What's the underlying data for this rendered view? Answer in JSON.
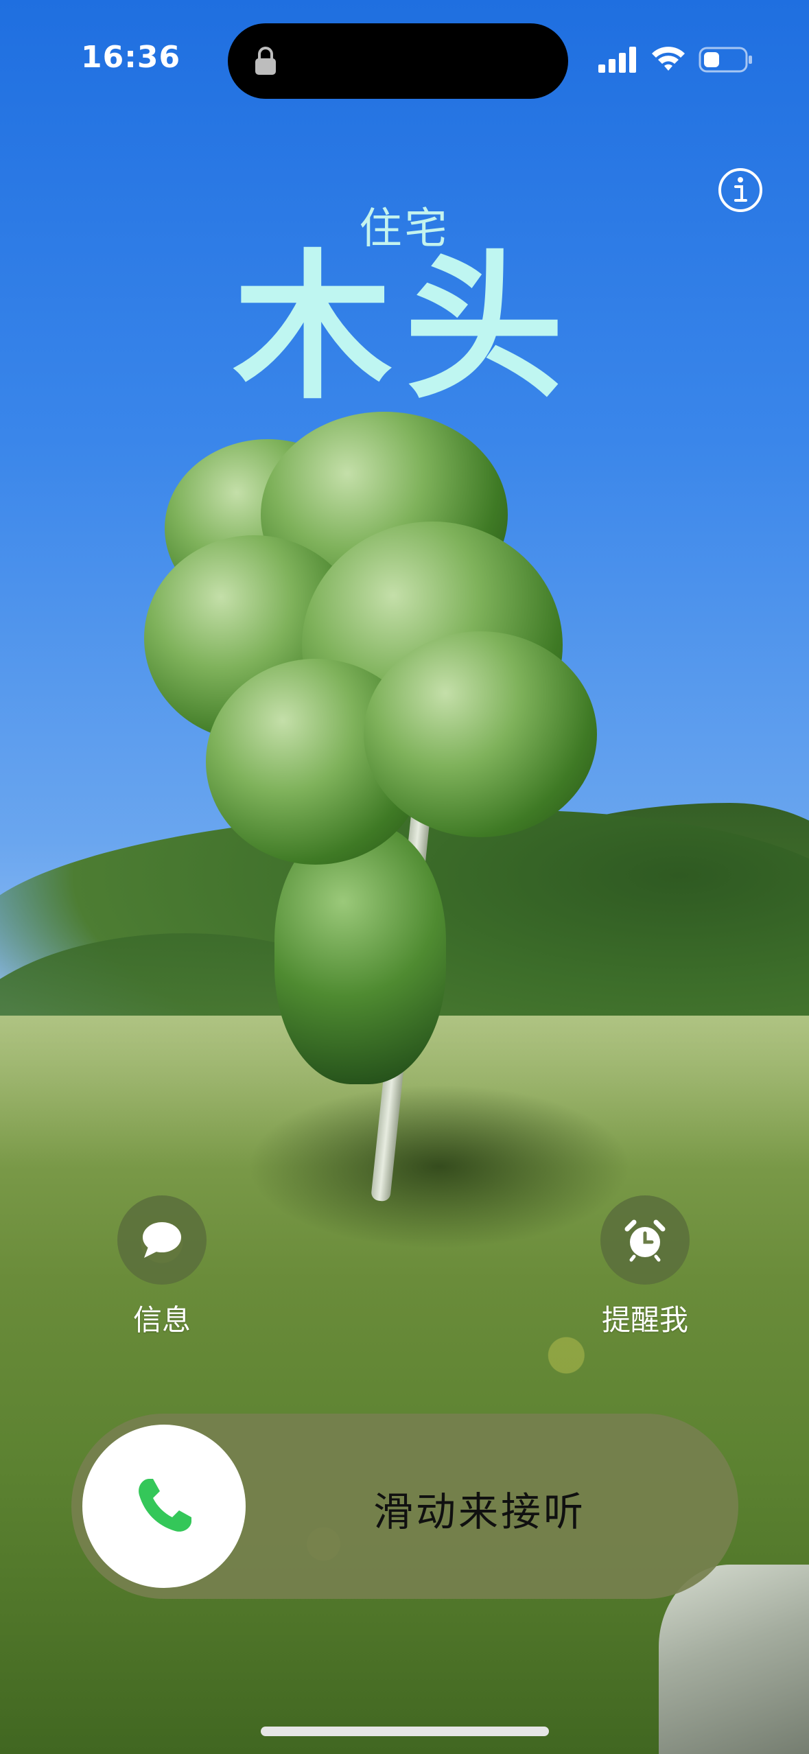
{
  "status_bar": {
    "time": "16:36",
    "icons": [
      "lock-icon",
      "signal-icon",
      "wifi-icon",
      "battery-icon"
    ]
  },
  "call": {
    "label": "住宅",
    "name": "木头"
  },
  "actions": {
    "message_label": "信息",
    "message_icon": "message-bubble-icon",
    "remind_label": "提醒我",
    "remind_icon": "alarm-clock-icon"
  },
  "slider": {
    "text": "滑动来接听",
    "icon": "phone-icon"
  },
  "colors": {
    "name_text": "#bff6f1",
    "answer_green": "#34c759"
  }
}
